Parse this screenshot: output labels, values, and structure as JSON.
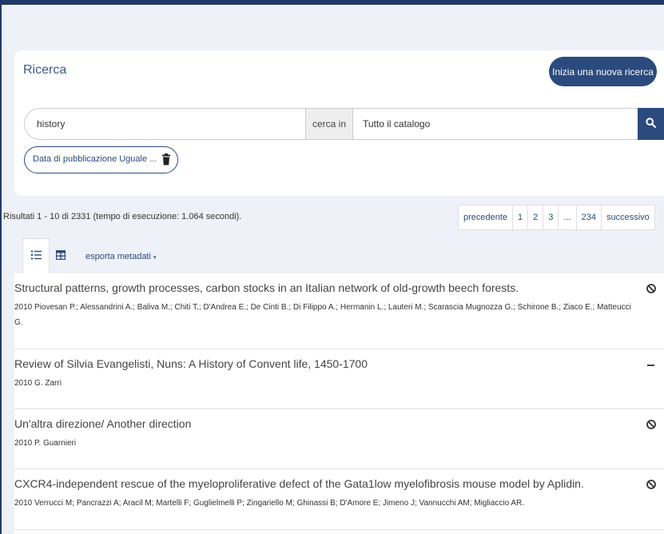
{
  "search": {
    "title": "Ricerca",
    "new_search_label": "Inizia una nuova ricerca",
    "query": "history",
    "cerca_in_label": "cerca in",
    "scope": "Tutto il catalogo"
  },
  "filter": {
    "label": "Data di pubblicazione Uguale ..."
  },
  "results_summary": "Risultati 1 - 10 di 2331 (tempo di esecuzione: 1.064 secondi).",
  "pagination": {
    "prev": "precedente",
    "pages": [
      "1",
      "2",
      "3",
      "...",
      "234"
    ],
    "next": "successivo"
  },
  "export_label": "esporta metadati",
  "results": [
    {
      "title": "Structural patterns, growth processes, carbon stocks in an Italian network of old-growth beech forests.",
      "meta": "2010 Piovesan P.; Alessandrini A.; Baliva M.; Chiti T.; D'Andrea E.; De Cinti B.; Di Filippo A.; Hermanin L.; Lauteri M.; Scarascia Mugnozza G.; Schirone B.; Ziaco E.; Matteucci G.",
      "status": "restricted"
    },
    {
      "title": "Review of Silvia Evangelisti, Nuns: A History of Convent life, 1450-1700",
      "meta": "2010 G. Zarri",
      "status": "none"
    },
    {
      "title": "Un'altra direzione/ Another direction",
      "meta": "2010 P. Guarnieri",
      "status": "restricted"
    },
    {
      "title": "CXCR4-independent rescue of the myeloproliferative defect of the Gata1low myelofibrosis mouse model by Aplidin.",
      "meta": "2010 Verrucci M; Pancrazzi A; Aracil M; Martelli F; Guglielmelli P; Zingariello M; Ghinassi B; D'Amore E; Jimeno J; Vannucchi AM; Migliaccio AR.",
      "status": "restricted"
    }
  ],
  "colors": {
    "primary": "#2b4b7e",
    "background": "#eef1f7"
  }
}
